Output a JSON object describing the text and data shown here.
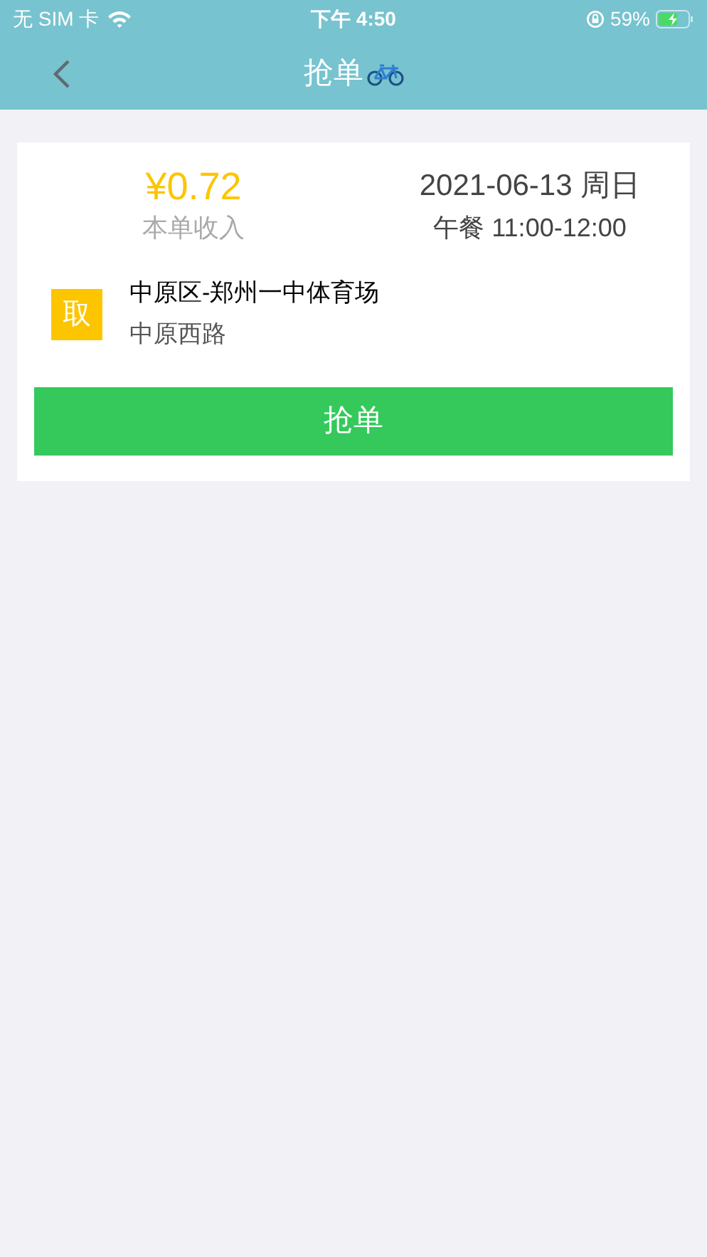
{
  "status_bar": {
    "carrier": "无 SIM 卡",
    "time": "下午 4:50",
    "battery": "59%"
  },
  "nav": {
    "title": "抢单"
  },
  "order": {
    "income": "¥0.72",
    "income_label": "本单收入",
    "date": "2021-06-13 周日",
    "slot": "午餐 11:00-12:00",
    "stops": [
      {
        "tag": "取",
        "name": "中原区-郑州一中体育场",
        "address": "中原西路"
      }
    ],
    "button": "抢单"
  }
}
